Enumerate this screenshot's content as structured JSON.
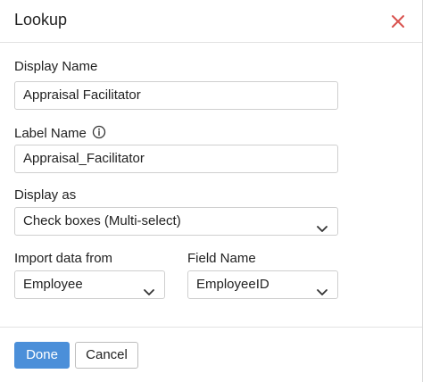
{
  "dialog": {
    "title": "Lookup",
    "close_color": "#d9534f"
  },
  "form": {
    "display_name": {
      "label": "Display Name",
      "value": "Appraisal Facilitator"
    },
    "label_name": {
      "label": "Label Name",
      "value": "Appraisal_Facilitator",
      "icon": "info-icon"
    },
    "display_as": {
      "label": "Display as",
      "value": "Check boxes (Multi-select)"
    },
    "import_data_from": {
      "label": "Import data from",
      "value": "Employee"
    },
    "field_name": {
      "label": "Field Name",
      "value": "EmployeeID"
    }
  },
  "footer": {
    "done_label": "Done",
    "cancel_label": "Cancel",
    "primary_color": "#4b8fd9"
  }
}
